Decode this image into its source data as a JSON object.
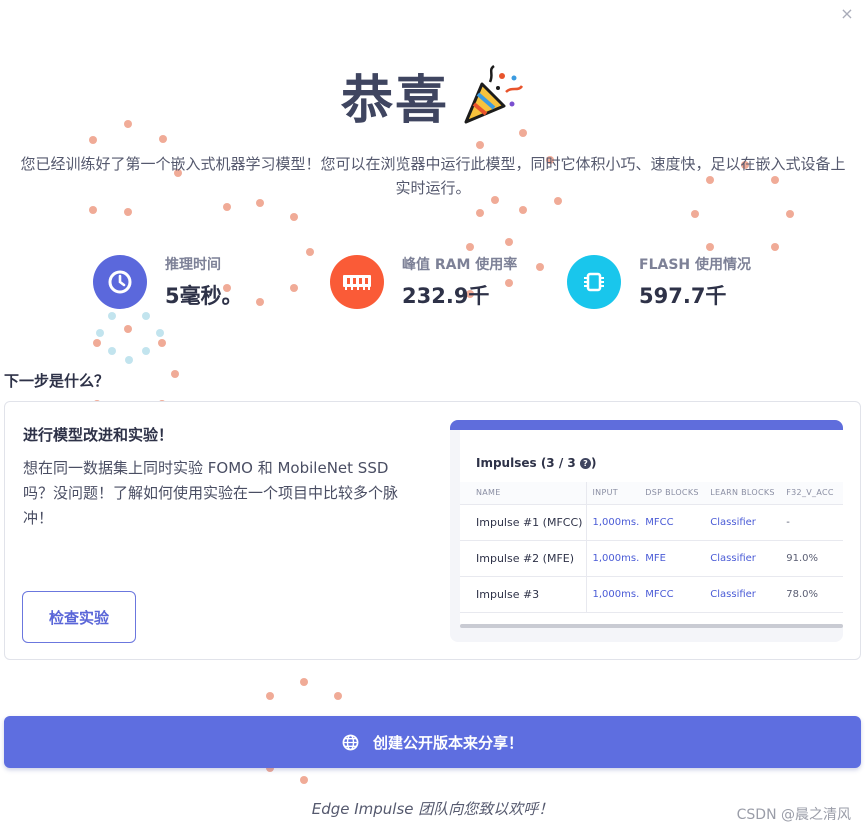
{
  "dialog": {
    "close_symbol": "×",
    "title": "恭喜",
    "title_icon": "party-popper-icon",
    "intro": "您已经训练好了第一个嵌入式机器学习模型！您可以在浏览器中运行此模型，同时它体积小巧、速度快，足以在嵌入式设备上实时运行。"
  },
  "stats": [
    {
      "label": "推理时间",
      "value": "5毫秒。",
      "icon": "clock-icon",
      "color": "#5b68dc"
    },
    {
      "label": "峰值 RAM 使用率",
      "value": "232.9千",
      "icon": "memory-icon",
      "color": "#fa5b37"
    },
    {
      "label": "FLASH 使用情况",
      "value": "597.7千",
      "icon": "chip-icon",
      "color": "#19c6ec"
    }
  ],
  "next_steps": {
    "heading": "下一步是什么？",
    "card": {
      "title": "进行模型改进和实验！",
      "body": "想在同一数据集上同时实验 FOMO 和 MobileNet SSD 吗？没问题！了解如何使用实验在一个项目中比较多个脉冲！",
      "button_label": "检查实验"
    },
    "preview": {
      "title": "Impulses (3 / 3",
      "help_symbol": "?",
      "title_close": ")",
      "columns": [
        "NAME",
        "INPUT",
        "DSP BLOCKS",
        "LEARN BLOCKS",
        "F32_V_ACC"
      ],
      "rows": [
        [
          "Impulse #1 (MFCC)",
          "1,000ms.",
          "MFCC",
          "Classifier",
          "-"
        ],
        [
          "Impulse #2 (MFE)",
          "1,000ms.",
          "MFE",
          "Classifier",
          "91.0%"
        ],
        [
          "Impulse #3",
          "1,000ms.",
          "MFCC",
          "Classifier",
          "78.0%"
        ]
      ]
    }
  },
  "share_button": {
    "label": "创建公开版本来分享！",
    "icon": "globe-icon"
  },
  "footer": "Edge Impulse 团队向您致以欢呼！",
  "watermark": "CSDN @晨之清风",
  "colors": {
    "accent": "#5e6ee0",
    "confetti_orange": "#ee9d86",
    "confetti_blue": "#bfe3ee",
    "confetti_green": "#d8e4a0"
  }
}
